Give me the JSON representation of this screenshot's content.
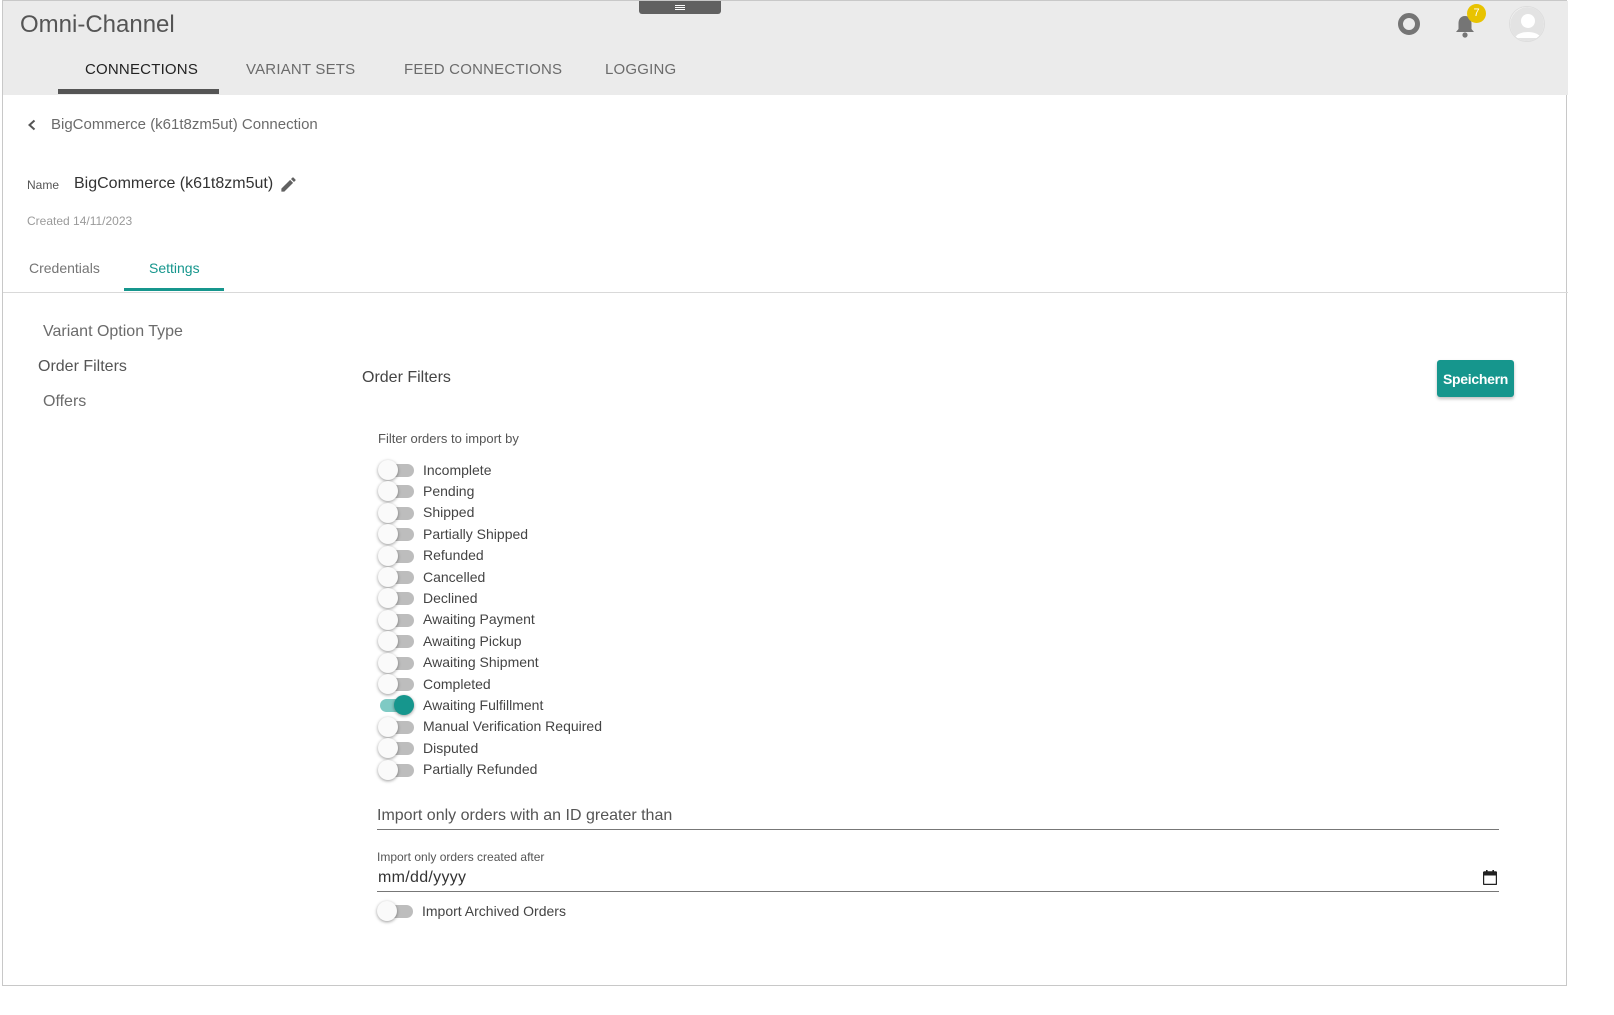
{
  "app": {
    "title": "Omni-Channel",
    "notification_count": "7"
  },
  "main_tabs": [
    {
      "label": "CONNECTIONS",
      "active": true
    },
    {
      "label": "VARIANT SETS",
      "active": false
    },
    {
      "label": "FEED CONNECTIONS",
      "active": false
    },
    {
      "label": "LOGGING",
      "active": false
    }
  ],
  "breadcrumb": {
    "title": "BigCommerce (k61t8zm5ut) Connection"
  },
  "connection": {
    "name_label": "Name",
    "name_value": "BigCommerce (k61t8zm5ut)",
    "created": "Created 14/11/2023"
  },
  "sub_tabs": [
    {
      "label": "Credentials",
      "active": false
    },
    {
      "label": "Settings",
      "active": true
    }
  ],
  "side_nav": [
    {
      "label": "Variant Option Type",
      "active": false
    },
    {
      "label": "Order Filters",
      "active": true
    },
    {
      "label": "Offers",
      "active": false
    }
  ],
  "order_filters": {
    "title": "Order Filters",
    "save_label": "Speichern",
    "caption": "Filter orders to import by",
    "statuses": [
      {
        "label": "Incomplete",
        "on": false
      },
      {
        "label": "Pending",
        "on": false
      },
      {
        "label": "Shipped",
        "on": false
      },
      {
        "label": "Partially Shipped",
        "on": false
      },
      {
        "label": "Refunded",
        "on": false
      },
      {
        "label": "Cancelled",
        "on": false
      },
      {
        "label": "Declined",
        "on": false
      },
      {
        "label": "Awaiting Payment",
        "on": false
      },
      {
        "label": "Awaiting Pickup",
        "on": false
      },
      {
        "label": "Awaiting Shipment",
        "on": false
      },
      {
        "label": "Completed",
        "on": false
      },
      {
        "label": "Awaiting Fulfillment",
        "on": true
      },
      {
        "label": "Manual Verification Required",
        "on": false
      },
      {
        "label": "Disputed",
        "on": false
      },
      {
        "label": "Partially Refunded",
        "on": false
      }
    ],
    "id_field_placeholder": "Import only orders with an ID greater than",
    "date_caption": "Import only orders created after",
    "date_value": "mm/dd/yyyy",
    "archived": {
      "label": "Import Archived Orders",
      "on": false
    }
  },
  "colors": {
    "accent": "#16968d",
    "badge": "#e8c300",
    "topbar": "#ebebeb"
  },
  "icons": [
    "menu-icon",
    "help-icon",
    "bell-icon",
    "avatar-icon",
    "chevron-left-icon",
    "pencil-icon",
    "calendar-icon"
  ]
}
